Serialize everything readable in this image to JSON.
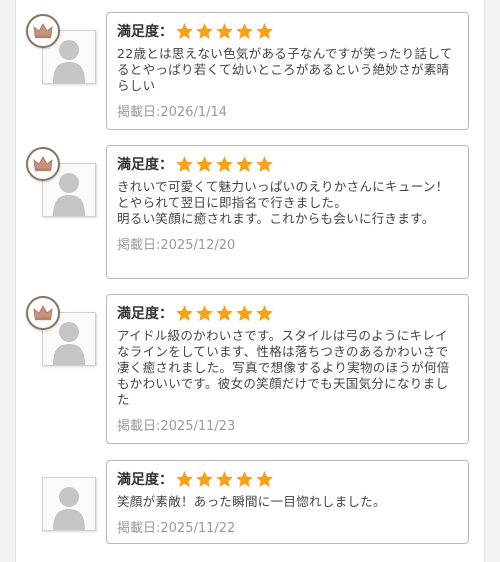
{
  "colors": {
    "star": "#f5a21a",
    "crown": "#c8927a",
    "avatar": "#c5c5c5"
  },
  "reviews": [
    {
      "ranked": true,
      "rating_label": "満足度：",
      "stars": 5,
      "text": "22歳とは思えない色気がある子なんですが笑ったり話してるとやっぱり若くて幼いところがあるという絶妙さが素晴らしい",
      "date": "掲載日:2026/1/14"
    },
    {
      "ranked": true,
      "rating_label": "満足度：",
      "stars": 5,
      "text": "きれいで可愛くて魅力いっぱいのえりかさんにキューン！とやられて翌日に即指名で行きました。\n明るい笑顔に癒されます。これからも会いに行きます。",
      "date": "掲載日:2025/12/20"
    },
    {
      "ranked": true,
      "rating_label": "満足度：",
      "stars": 5,
      "text": "アイドル級のかわいさです。スタイルは弓のようにキレイなラインをしています、性格は落ちつきのあるかわいさで凄く癒されました。写真で想像するより実物のほうが何倍もかわいいです。彼女の笑顔だけでも天国気分になりました",
      "date": "掲載日:2025/11/23"
    },
    {
      "ranked": false,
      "rating_label": "満足度：",
      "stars": 5,
      "text": "笑顔が素敵！あった瞬間に一目惚れしました。",
      "date": "掲載日:2025/11/22"
    }
  ]
}
